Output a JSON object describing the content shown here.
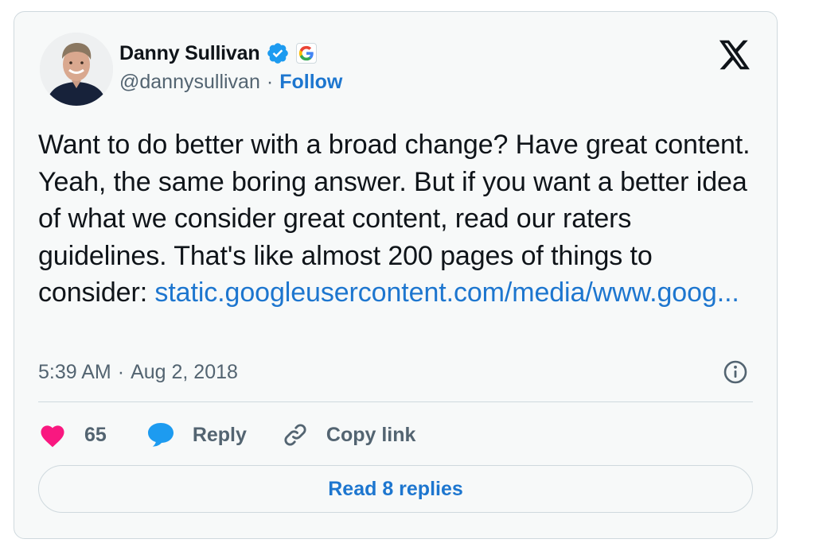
{
  "author": {
    "name": "Danny Sullivan",
    "handle": "@dannysullivan",
    "separator": "·",
    "follow_label": "Follow",
    "verified_color": "#1d9bf0"
  },
  "tweet": {
    "text": "Want to do better with a broad change? Have great content. Yeah, the same boring answer. But if you want a better idea of what we consider great content, read our raters guidelines. That's like almost 200 pages of things to consider:",
    "link_text": "static.googleusercontent.com/media/www.goog...",
    "time": "5:39 AM",
    "separator": "·",
    "date": "Aug 2, 2018"
  },
  "actions": {
    "like_count": "65",
    "reply_label": "Reply",
    "copy_link_label": "Copy link"
  },
  "replies_button_label": "Read 8 replies",
  "colors": {
    "accent": "#1d76cf",
    "like": "#f91880",
    "reply": "#1d9bf0",
    "muted": "#536471",
    "border": "#cfd9de"
  }
}
